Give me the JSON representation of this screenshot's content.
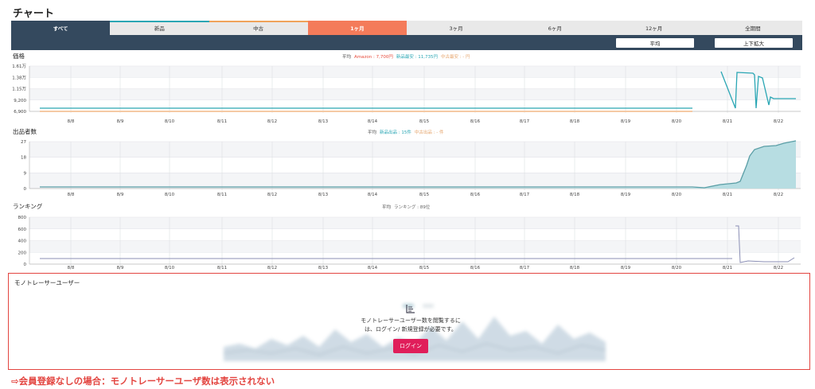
{
  "page": {
    "title": "チャート"
  },
  "tabs": [
    {
      "label": "すべて",
      "state": "active-all",
      "bar": ""
    },
    {
      "label": "新品",
      "state": "",
      "bar": "#2aa6b4"
    },
    {
      "label": "中古",
      "state": "",
      "bar": "#f0a35a"
    },
    {
      "label": "1ヶ月",
      "state": "active-range",
      "bar": ""
    },
    {
      "label": "3ヶ月",
      "state": "",
      "bar": ""
    },
    {
      "label": "6ヶ月",
      "state": "",
      "bar": ""
    },
    {
      "label": "12ヶ月",
      "state": "",
      "bar": ""
    },
    {
      "label": "全期間",
      "state": "",
      "bar": ""
    }
  ],
  "toolbar": {
    "avg_label": "平均",
    "zoom_label": "上下拡大"
  },
  "x_dates": [
    "8/8",
    "8/9",
    "8/10",
    "8/11",
    "8/12",
    "8/13",
    "8/14",
    "8/15",
    "8/16",
    "8/17",
    "8/18",
    "8/19",
    "8/20",
    "8/21",
    "8/22"
  ],
  "price": {
    "label": "価格",
    "legend": {
      "avg": "平均",
      "amazon": "Amazon : 7,700円",
      "new": "新品最安 : 11,735円",
      "used": "中古最安 : - 円"
    },
    "y_ticks": [
      "1.61万",
      "1.38万",
      "1.15万",
      "9,200",
      "6,900"
    ]
  },
  "sellers": {
    "label": "出品者数",
    "legend": {
      "avg": "平均",
      "new": "新品出品 : 15件",
      "used": "中古出品 : - 件"
    },
    "y_ticks": [
      "27",
      "18",
      "9",
      "0"
    ]
  },
  "ranking": {
    "label": "ランキング",
    "legend": {
      "avg": "平均",
      "rank": "ランキング : 89位"
    },
    "y_ticks": [
      "800",
      "600",
      "400",
      "200",
      "0"
    ]
  },
  "mono": {
    "label": "モノトレーサーユーザー",
    "message_1": "モノトレーサーユーザー数を閲覧するに",
    "message_2": "は、ログイン/ 新規登録が必要です。",
    "login_label": "ログイン",
    "chart_icon": "chart-icon"
  },
  "note": "⇨会員登録なしの場合：モノトレーサーユーザ数は表示されない",
  "colors": {
    "navy": "#34495e",
    "accent": "#f47b5a",
    "teal": "#2aa6b4",
    "red": "#e34540",
    "pink": "#e01e5a"
  }
}
